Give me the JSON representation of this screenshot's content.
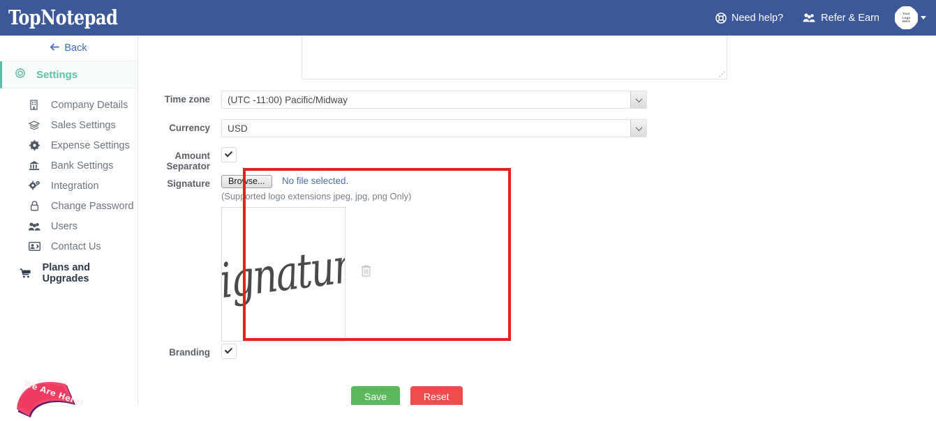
{
  "header": {
    "brand": "TopNotepad",
    "need_help": "Need help?",
    "refer_earn": "Refer & Earn",
    "avatar_line1": "Your",
    "avatar_line2": "Logo",
    "avatar_line3": "Here"
  },
  "sidebar": {
    "back": "Back",
    "section_title": "Settings",
    "items": [
      {
        "label": "Company Details",
        "icon": "building-icon"
      },
      {
        "label": "Sales Settings",
        "icon": "layers-icon"
      },
      {
        "label": "Expense Settings",
        "icon": "gear-icon"
      },
      {
        "label": "Bank Settings",
        "icon": "bank-icon"
      },
      {
        "label": "Integration",
        "icon": "cogs-icon"
      },
      {
        "label": "Change Password",
        "icon": "lock-icon"
      },
      {
        "label": "Users",
        "icon": "users-icon"
      },
      {
        "label": "Contact Us",
        "icon": "contact-card-icon"
      }
    ],
    "plans": "Plans and Upgrades",
    "ribbon": "We Are Here!"
  },
  "form": {
    "timezone_label": "Time zone",
    "timezone_value": "(UTC -11:00) Pacific/Midway",
    "currency_label": "Currency",
    "currency_value": "USD",
    "amount_separator_label": "Amount Separator",
    "signature_label": "Signature",
    "browse_button": "Browse...",
    "no_file": "No file selected.",
    "extensions_hint": "(Supported logo extensions jpeg, jpg, png Only)",
    "signature_image_text": "Signature",
    "branding_label": "Branding",
    "save_button": "Save",
    "reset_button": "Reset"
  },
  "colors": {
    "navbar": "#3b5998",
    "accent_green": "#5bc0a5",
    "highlight_red": "#e32219",
    "save_green": "#5cb85c",
    "reset_red": "#ef4d4d",
    "link_blue": "#3d6ec1"
  }
}
